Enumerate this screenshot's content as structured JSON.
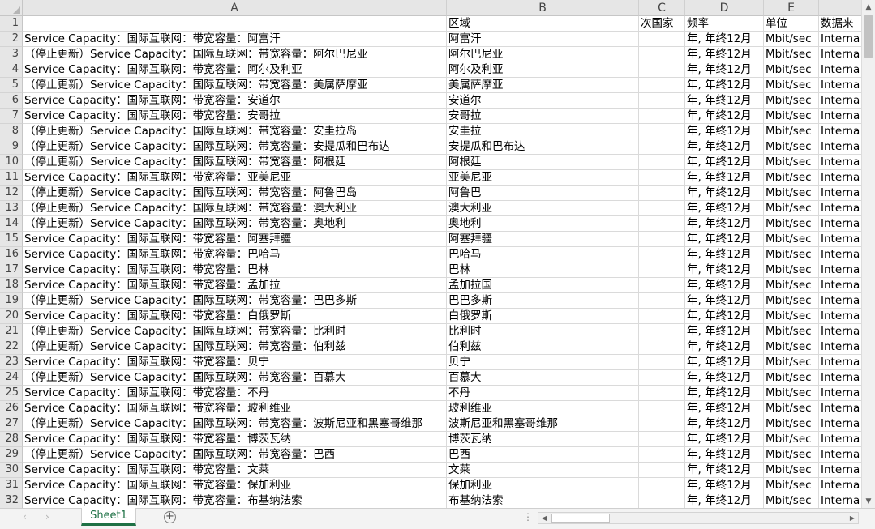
{
  "columns": [
    "A",
    "B",
    "C",
    "D",
    "E"
  ],
  "header_row": {
    "row": "1",
    "a": "",
    "b": "区域",
    "c": "次国家",
    "d": "频率",
    "e": "单位",
    "f": "数据来"
  },
  "rows": [
    {
      "row": "2",
      "a": "Service Capacity：国际互联网：带宽容量：阿富汗",
      "b": "阿富汗",
      "c": "",
      "d": "年, 年终12月",
      "e": "Mbit/sec",
      "f": "Interna"
    },
    {
      "row": "3",
      "a": "（停止更新）Service Capacity：国际互联网：带宽容量：阿尔巴尼亚",
      "b": "阿尔巴尼亚",
      "c": "",
      "d": "年, 年终12月",
      "e": "Mbit/sec",
      "f": "Interna"
    },
    {
      "row": "4",
      "a": "Service Capacity：国际互联网：带宽容量：阿尔及利亚",
      "b": "阿尔及利亚",
      "c": "",
      "d": "年, 年终12月",
      "e": "Mbit/sec",
      "f": "Interna"
    },
    {
      "row": "5",
      "a": "（停止更新）Service Capacity：国际互联网：带宽容量：美属萨摩亚",
      "b": "美属萨摩亚",
      "c": "",
      "d": "年, 年终12月",
      "e": "Mbit/sec",
      "f": "Interna"
    },
    {
      "row": "6",
      "a": "Service Capacity：国际互联网：带宽容量：安道尔",
      "b": "安道尔",
      "c": "",
      "d": "年, 年终12月",
      "e": "Mbit/sec",
      "f": "Interna"
    },
    {
      "row": "7",
      "a": "Service Capacity：国际互联网：带宽容量：安哥拉",
      "b": "安哥拉",
      "c": "",
      "d": "年, 年终12月",
      "e": "Mbit/sec",
      "f": "Interna"
    },
    {
      "row": "8",
      "a": "（停止更新）Service Capacity：国际互联网：带宽容量：安圭拉岛",
      "b": "安圭拉",
      "c": "",
      "d": "年, 年终12月",
      "e": "Mbit/sec",
      "f": "Interna"
    },
    {
      "row": "9",
      "a": "（停止更新）Service Capacity：国际互联网：带宽容量：安提瓜和巴布达",
      "b": "安提瓜和巴布达",
      "c": "",
      "d": "年, 年终12月",
      "e": "Mbit/sec",
      "f": "Interna"
    },
    {
      "row": "10",
      "a": "（停止更新）Service Capacity：国际互联网：带宽容量：阿根廷",
      "b": "阿根廷",
      "c": "",
      "d": "年, 年终12月",
      "e": "Mbit/sec",
      "f": "Interna"
    },
    {
      "row": "11",
      "a": "Service Capacity：国际互联网：带宽容量：亚美尼亚",
      "b": "亚美尼亚",
      "c": "",
      "d": "年, 年终12月",
      "e": "Mbit/sec",
      "f": "Interna"
    },
    {
      "row": "12",
      "a": "（停止更新）Service Capacity：国际互联网：带宽容量：阿鲁巴岛",
      "b": "阿鲁巴",
      "c": "",
      "d": "年, 年终12月",
      "e": "Mbit/sec",
      "f": "Interna"
    },
    {
      "row": "13",
      "a": "（停止更新）Service Capacity：国际互联网：带宽容量：澳大利亚",
      "b": "澳大利亚",
      "c": "",
      "d": "年, 年终12月",
      "e": "Mbit/sec",
      "f": "Interna"
    },
    {
      "row": "14",
      "a": "（停止更新）Service Capacity：国际互联网：带宽容量：奥地利",
      "b": "奥地利",
      "c": "",
      "d": "年, 年终12月",
      "e": "Mbit/sec",
      "f": "Interna"
    },
    {
      "row": "15",
      "a": "Service Capacity：国际互联网：带宽容量：阿塞拜疆",
      "b": "阿塞拜疆",
      "c": "",
      "d": "年, 年终12月",
      "e": "Mbit/sec",
      "f": "Interna"
    },
    {
      "row": "16",
      "a": "Service Capacity：国际互联网：带宽容量：巴哈马",
      "b": "巴哈马",
      "c": "",
      "d": "年, 年终12月",
      "e": "Mbit/sec",
      "f": "Interna"
    },
    {
      "row": "17",
      "a": "Service Capacity：国际互联网：带宽容量：巴林",
      "b": "巴林",
      "c": "",
      "d": "年, 年终12月",
      "e": "Mbit/sec",
      "f": "Interna"
    },
    {
      "row": "18",
      "a": "Service Capacity：国际互联网：带宽容量：孟加拉",
      "b": "孟加拉国",
      "c": "",
      "d": "年, 年终12月",
      "e": "Mbit/sec",
      "f": "Interna"
    },
    {
      "row": "19",
      "a": "（停止更新）Service Capacity：国际互联网：带宽容量：巴巴多斯",
      "b": "巴巴多斯",
      "c": "",
      "d": "年, 年终12月",
      "e": "Mbit/sec",
      "f": "Interna"
    },
    {
      "row": "20",
      "a": "Service Capacity：国际互联网：带宽容量：白俄罗斯",
      "b": "白俄罗斯",
      "c": "",
      "d": "年, 年终12月",
      "e": "Mbit/sec",
      "f": "Interna"
    },
    {
      "row": "21",
      "a": "（停止更新）Service Capacity：国际互联网：带宽容量：比利时",
      "b": "比利时",
      "c": "",
      "d": "年, 年终12月",
      "e": "Mbit/sec",
      "f": "Interna"
    },
    {
      "row": "22",
      "a": "（停止更新）Service Capacity：国际互联网：带宽容量：伯利兹",
      "b": "伯利兹",
      "c": "",
      "d": "年, 年终12月",
      "e": "Mbit/sec",
      "f": "Interna"
    },
    {
      "row": "23",
      "a": "Service Capacity：国际互联网：带宽容量：贝宁",
      "b": "贝宁",
      "c": "",
      "d": "年, 年终12月",
      "e": "Mbit/sec",
      "f": "Interna"
    },
    {
      "row": "24",
      "a": "（停止更新）Service Capacity：国际互联网：带宽容量：百慕大",
      "b": "百慕大",
      "c": "",
      "d": "年, 年终12月",
      "e": "Mbit/sec",
      "f": "Interna"
    },
    {
      "row": "25",
      "a": "Service Capacity：国际互联网：带宽容量：不丹",
      "b": "不丹",
      "c": "",
      "d": "年, 年终12月",
      "e": "Mbit/sec",
      "f": "Interna"
    },
    {
      "row": "26",
      "a": "Service Capacity：国际互联网：带宽容量：玻利维亚",
      "b": "玻利维亚",
      "c": "",
      "d": "年, 年终12月",
      "e": "Mbit/sec",
      "f": "Interna"
    },
    {
      "row": "27",
      "a": "（停止更新）Service Capacity：国际互联网：带宽容量：波斯尼亚和黑塞哥维那",
      "b": "波斯尼亚和黑塞哥维那",
      "c": "",
      "d": "年, 年终12月",
      "e": "Mbit/sec",
      "f": "Interna"
    },
    {
      "row": "28",
      "a": "Service Capacity：国际互联网：带宽容量：博茨瓦纳",
      "b": "博茨瓦纳",
      "c": "",
      "d": "年, 年终12月",
      "e": "Mbit/sec",
      "f": "Interna"
    },
    {
      "row": "29",
      "a": "（停止更新）Service Capacity：国际互联网：带宽容量：巴西",
      "b": "巴西",
      "c": "",
      "d": "年, 年终12月",
      "e": "Mbit/sec",
      "f": "Interna"
    },
    {
      "row": "30",
      "a": "Service Capacity：国际互联网：带宽容量：文莱",
      "b": "文莱",
      "c": "",
      "d": "年, 年终12月",
      "e": "Mbit/sec",
      "f": "Interna"
    },
    {
      "row": "31",
      "a": "Service Capacity：国际互联网：带宽容量：保加利亚",
      "b": "保加利亚",
      "c": "",
      "d": "年, 年终12月",
      "e": "Mbit/sec",
      "f": "Interna"
    },
    {
      "row": "32",
      "a": "Service Capacity：国际互联网：带宽容量：布基纳法索",
      "b": "布基纳法索",
      "c": "",
      "d": "年, 年终12月",
      "e": "Mbit/sec",
      "f": "Interna"
    }
  ],
  "sheet_tabs": [
    {
      "label": "Sheet1",
      "active": true
    }
  ],
  "icons": {
    "select_all": "select-all-triangle",
    "add_sheet": "plus-circle-icon",
    "prev_sheet": "chevron-left-icon",
    "next_sheet": "chevron-right-icon",
    "tab_split": "vertical-dots-icon",
    "scroll_up": "triangle-up-icon",
    "scroll_down": "triangle-down-icon",
    "scroll_left": "triangle-left-icon",
    "scroll_right": "triangle-right-icon"
  },
  "glyphs": {
    "prev": "‹",
    "next": "›",
    "add": "+",
    "split": "⋮",
    "up": "▲",
    "down": "▼",
    "left": "◀",
    "right": "▶"
  },
  "colors": {
    "header_bg": "#e6e6e6",
    "gridline": "#dadada",
    "active_tab_accent": "#1e7145"
  }
}
